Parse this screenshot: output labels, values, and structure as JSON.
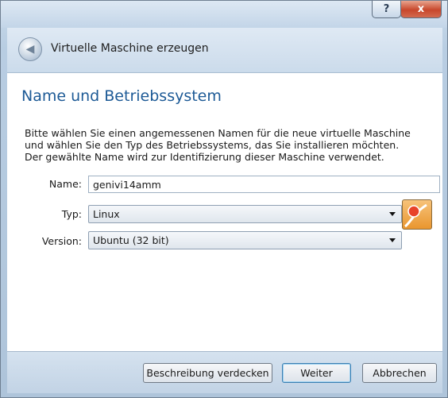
{
  "window": {
    "help_label": "?",
    "close_label": "x",
    "title": "Virtuelle Maschine erzeugen"
  },
  "page": {
    "title": "Name und Betriebssystem",
    "description_lines": [
      "Bitte wählen Sie einen angemessenen Namen für die neue virtuelle Maschine",
      "und wählen Sie den Typ des Betriebssystems, das Sie installieren möchten.",
      "Der gewählte Name wird zur Identifizierung dieser Maschine verwendet."
    ]
  },
  "form": {
    "name_label": "Name:",
    "name_value": "genivi14amm",
    "type_label": "Typ:",
    "type_value": "Linux",
    "version_label": "Version:",
    "version_value": "Ubuntu (32 bit)"
  },
  "buttons": {
    "hide_description": "Beschreibung verdecken",
    "next": "Weiter",
    "cancel": "Abbrechen"
  },
  "icons": {
    "back": "back-arrow-icon",
    "os_type": "linux-os-icon"
  },
  "colors": {
    "accent_title": "#1d5a96",
    "close_button": "#c8472c"
  }
}
